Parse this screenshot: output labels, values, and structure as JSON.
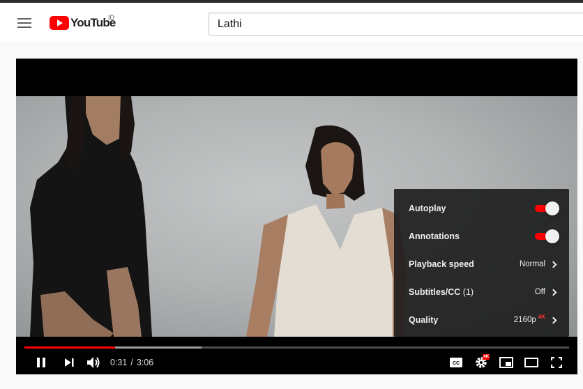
{
  "masthead": {
    "logo_text": "YouTube",
    "country_code": "ID",
    "search": {
      "value": "Lathi"
    }
  },
  "player": {
    "progress": {
      "played_fraction": 0.1667,
      "loaded_fraction": 0.325
    },
    "time": {
      "current": "0:31",
      "separator": "/",
      "duration": "3:06"
    },
    "settings": {
      "autoplay": {
        "label": "Autoplay",
        "enabled": true
      },
      "annotations": {
        "label": "Annotations",
        "enabled": true
      },
      "playback_speed": {
        "label": "Playback speed",
        "value": "Normal"
      },
      "subtitles": {
        "label": "Subtitles/CC",
        "count": "(1)",
        "value": "Off"
      },
      "quality": {
        "label": "Quality",
        "value": "2160p",
        "badge": "4K"
      }
    },
    "settings_badge": "4K",
    "icons": {
      "pause": "pause-icon",
      "next": "next-icon",
      "volume": "volume-icon",
      "cc": "cc-icon",
      "settings": "gear-icon",
      "miniplayer": "miniplayer-icon",
      "theater": "theater-icon",
      "fullscreen": "fullscreen-icon"
    },
    "colors": {
      "accent": "#ff0000",
      "menu_bg": "#1c1c1c"
    }
  }
}
